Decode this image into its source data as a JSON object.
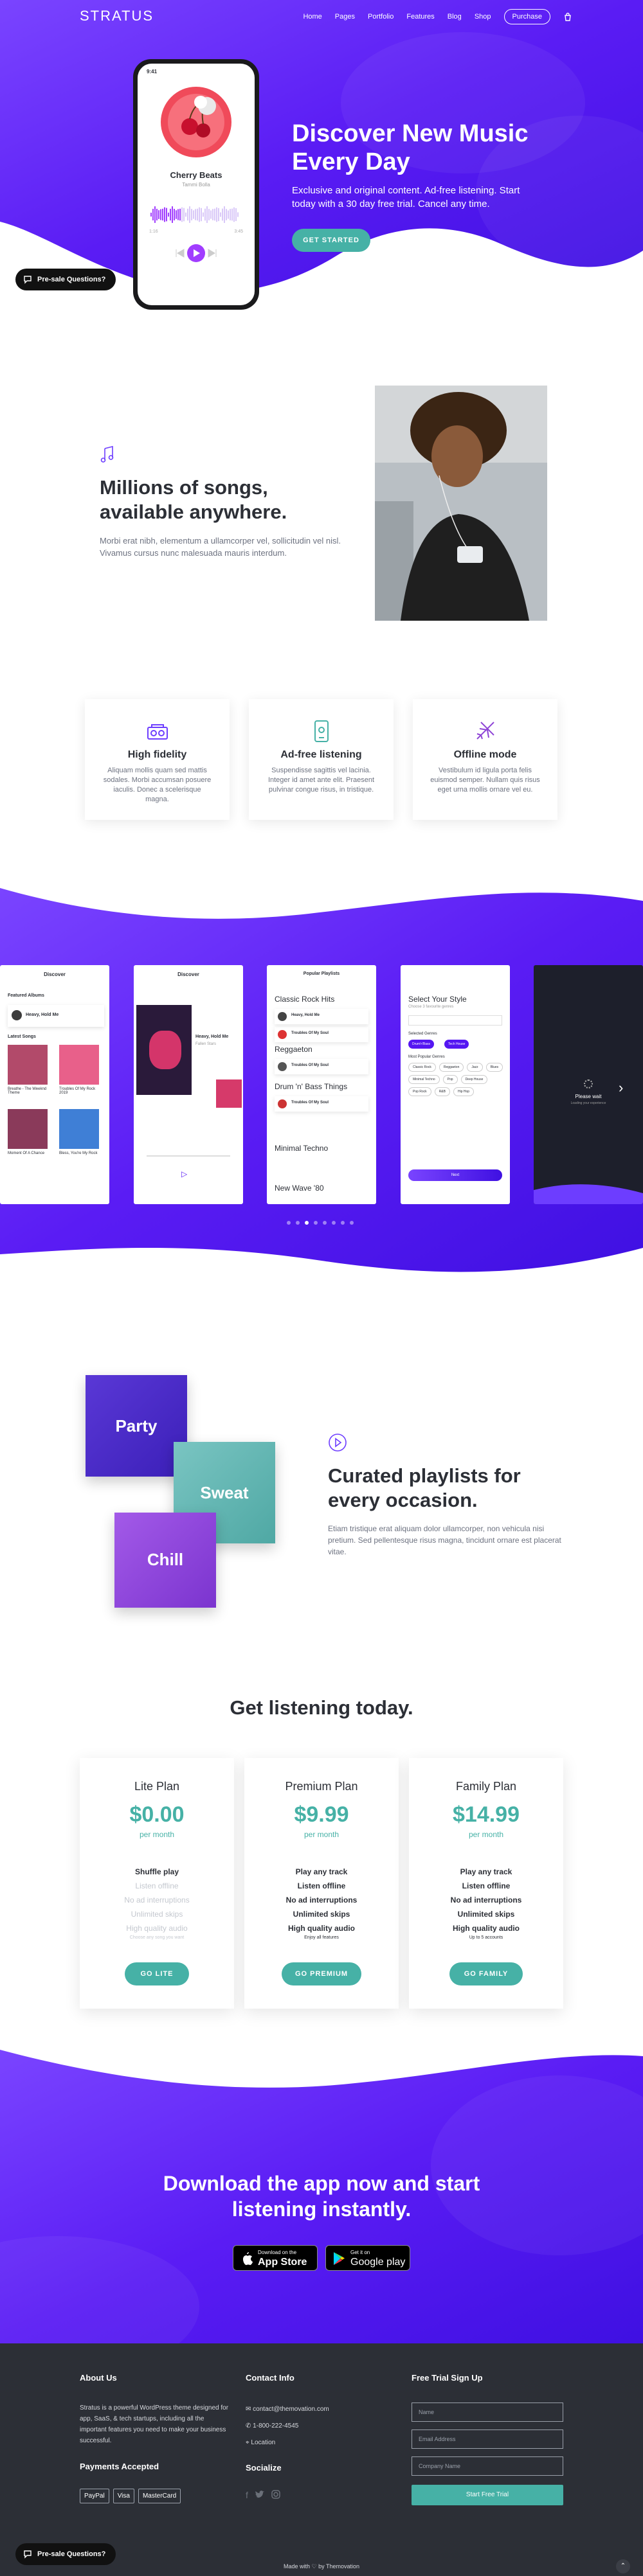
{
  "brand": "STRATUS",
  "nav": {
    "items": [
      "Home",
      "Pages",
      "Portfolio",
      "Features",
      "Blog",
      "Shop"
    ],
    "purchase": "Purchase"
  },
  "hero": {
    "title": "Discover New Music Every Day",
    "subtitle": "Exclusive and original content. Ad-free listening. Start today with a 30 day free trial. Cancel any time.",
    "cta": "GET STARTED",
    "phone": {
      "time": "9:41",
      "song": "Cherry Beats",
      "artist": "Tammi Bolla",
      "elapsed": "1:16",
      "total": "3:45"
    }
  },
  "presale": "Pre-sale Questions?",
  "songs": {
    "title": "Millions of songs, available anywhere.",
    "body": "Morbi erat nibh, elementum a ullamcorper vel, sollicitudin vel nisl. Vivamus cursus nunc malesuada mauris interdum."
  },
  "features": [
    {
      "title": "High fidelity",
      "text": "Aliquam mollis quam sed mattis sodales. Morbi accumsan posuere iaculis. Donec a scelerisque magna."
    },
    {
      "title": "Ad-free listening",
      "text": "Suspendisse sagittis vel lacinia. Integer id amet ante elit. Praesent pulvinar congue risus, in tristique."
    },
    {
      "title": "Offline mode",
      "text": "Vestibulum id ligula porta felis euismod semper. Nullam quis risus eget urna mollis ornare vel eu."
    }
  ],
  "screens": {
    "s1": {
      "header": "Discover",
      "featured": "Featured Albums",
      "track": "Heavy, Hold Me",
      "latest": "Latest Songs",
      "cards": [
        "Breathe - The Weeknd Theme",
        "Troubles Of My Rock 2019",
        "Moment Of A Chance",
        "Bless, You're My Rock"
      ]
    },
    "s2": {
      "header": "Discover",
      "track": "Heavy, Hold Me",
      "artist": "Fallen Stars"
    },
    "s3": {
      "header": "Popular Playlists",
      "lists": [
        "Classic Rock Hits",
        "Reggaeton",
        "Drum 'n' Bass Things",
        "Minimal Techno",
        "New Wave '80"
      ],
      "rows": [
        "Heavy, Hold Me",
        "Troubles Of My Soul",
        "Troubles Of My Soul",
        "Troubles Of My Soul"
      ]
    },
    "s4": {
      "header": "Select Your Style",
      "sub": "Choose 3 favourite genres",
      "selected": "Selected Genres",
      "chips_on": [
        "Drum'n'Bass",
        "Tech House"
      ],
      "most": "Most Popular Genres",
      "chips": [
        "Classic Rock",
        "Reggaeton",
        "Jazz",
        "Blues",
        "Minimal Techno",
        "Pop",
        "Deep House",
        "Pop Rock",
        "R&B",
        "Hip Hop"
      ],
      "next": "Next"
    },
    "s5": {
      "wait": "Please wait",
      "sub": "Loading your experience"
    }
  },
  "slider": {
    "dots": 8,
    "active": 2
  },
  "playlists": {
    "tiles": [
      "Party",
      "Sweat",
      "Chill"
    ],
    "title": "Curated playlists for every occasion.",
    "body": "Etiam tristique erat aliquam dolor ullamcorper, non vehicula nisi pretium. Sed pellentesque risus magna, tincidunt ornare est placerat vitae."
  },
  "pricing": {
    "title": "Get listening today.",
    "plans": [
      {
        "name": "Lite Plan",
        "price": "$0.00",
        "per": "per month",
        "features": [
          [
            "Shuffle play",
            true
          ],
          [
            "Listen offline",
            false
          ],
          [
            "No ad interruptions",
            false
          ],
          [
            "Unlimited skips",
            false
          ],
          [
            "High quality audio",
            false
          ]
        ],
        "note": "Choose any song you want",
        "cta": "GO LITE"
      },
      {
        "name": "Premium Plan",
        "price": "$9.99",
        "per": "per month",
        "features": [
          [
            "Play any track",
            true
          ],
          [
            "Listen offline",
            true
          ],
          [
            "No ad interruptions",
            true
          ],
          [
            "Unlimited skips",
            true
          ],
          [
            "High quality audio",
            true
          ]
        ],
        "note": "Enjoy all features",
        "cta": "GO PREMIUM"
      },
      {
        "name": "Family Plan",
        "price": "$14.99",
        "per": "per month",
        "features": [
          [
            "Play any track",
            true
          ],
          [
            "Listen offline",
            true
          ],
          [
            "No ad interruptions",
            true
          ],
          [
            "Unlimited skips",
            true
          ],
          [
            "High quality audio",
            true
          ]
        ],
        "note": "Up to 5 accounts",
        "cta": "GO FAMILY"
      }
    ]
  },
  "download": {
    "title": "Download the app now and start listening instantly.",
    "appstore": {
      "small": "Download on the",
      "big": "App Store"
    },
    "gplay": {
      "small": "Get it on",
      "big": "Google play"
    }
  },
  "footer": {
    "about_title": "About Us",
    "about_text": "Stratus is a powerful WordPress theme designed for app, SaaS, & tech startups, including all the important features you need to make your business successful.",
    "payments_title": "Payments Accepted",
    "payments": [
      "PayPal",
      "Visa",
      "MasterCard"
    ],
    "contact_title": "Contact Info",
    "contact": [
      "contact@themovation.com",
      "1-800-222-4545",
      "Location"
    ],
    "social_title": "Socialize",
    "signup_title": "Free Trial Sign Up",
    "fields": [
      "Name",
      "Email Address",
      "Company Name"
    ],
    "signup_cta": "Start Free Trial",
    "credit": "Made with ♡ by Themovation"
  },
  "colors": {
    "primary": "#5516f2",
    "accent": "#46b1a6",
    "dark": "#2c2f36"
  }
}
